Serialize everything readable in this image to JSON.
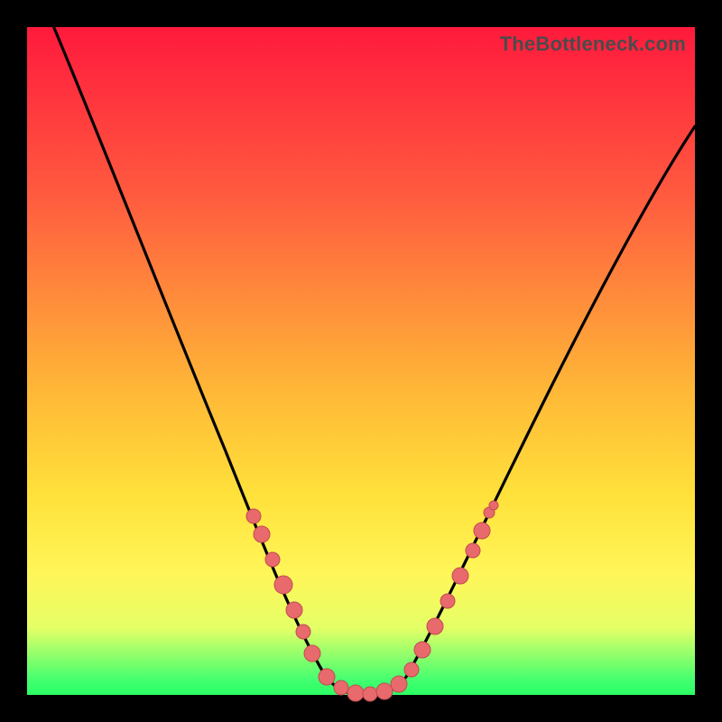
{
  "watermark": "TheBottleneck.com",
  "colors": {
    "frame": "#000000",
    "gradient_top": "#ff1a3c",
    "gradient_mid1": "#ff8a3b",
    "gradient_mid2": "#ffe13a",
    "gradient_bottom": "#2bff63",
    "curve_stroke": "#000000",
    "marker_fill": "#e86a6d",
    "marker_stroke": "#c24b4f"
  },
  "chart_data": {
    "type": "line",
    "title": "",
    "xlabel": "",
    "ylabel": "",
    "xlim": [
      0,
      100
    ],
    "ylim": [
      0,
      100
    ],
    "grid": false,
    "legend": false,
    "x": [
      4,
      8,
      12,
      16,
      20,
      24,
      28,
      30,
      32,
      34,
      36,
      38,
      40,
      42,
      44,
      46,
      48,
      50,
      52,
      54,
      56,
      58,
      60,
      64,
      68,
      72,
      76,
      80,
      84,
      88,
      92,
      96,
      100
    ],
    "y": [
      100,
      92,
      84,
      75,
      67,
      58,
      49,
      44,
      39,
      34,
      28,
      22,
      16,
      10,
      5,
      2,
      0,
      0,
      0,
      1,
      4,
      9,
      14,
      23,
      31,
      38,
      44,
      50,
      55,
      60,
      64,
      68,
      72
    ],
    "markers": {
      "left_segment_x": [
        30,
        32,
        34,
        36,
        38,
        40,
        42
      ],
      "left_segment_y": [
        44,
        39,
        34,
        28,
        22,
        16,
        10
      ],
      "bottom_segment_x": [
        44,
        46,
        48,
        50,
        52,
        54,
        56
      ],
      "bottom_segment_y": [
        5,
        2,
        0,
        0,
        0,
        1,
        4
      ],
      "right_segment_x": [
        58,
        60,
        62,
        64
      ],
      "right_segment_y": [
        9,
        14,
        18,
        23
      ]
    }
  }
}
